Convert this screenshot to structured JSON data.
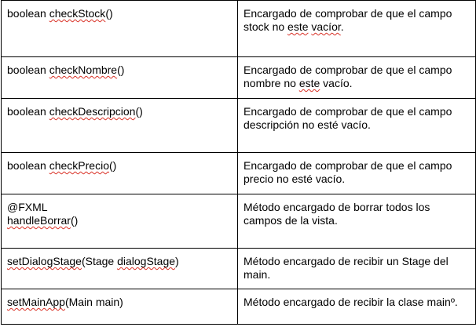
{
  "rows": [
    {
      "sig_parts": [
        {
          "t": "boolean ",
          "sq": false
        },
        {
          "t": "checkStock",
          "sq": true
        },
        {
          "t": "()",
          "sq": false
        }
      ],
      "desc_parts": [
        {
          "t": "Encargado de comprobar de que el campo stock no ",
          "sq": false
        },
        {
          "t": "este",
          "sq": true
        },
        {
          "t": " ",
          "sq": false
        },
        {
          "t": "vacíor",
          "sq": true
        },
        {
          "t": ".",
          "sq": false
        }
      ]
    },
    {
      "sig_parts": [
        {
          "t": "boolean ",
          "sq": false
        },
        {
          "t": "checkNombre",
          "sq": true
        },
        {
          "t": "()",
          "sq": false
        }
      ],
      "desc_parts": [
        {
          "t": "Encargado de comprobar de que el campo nombre no ",
          "sq": false
        },
        {
          "t": "este",
          "sq": true
        },
        {
          "t": " vacío.",
          "sq": false
        }
      ]
    },
    {
      "sig_parts": [
        {
          "t": "boolean ",
          "sq": false
        },
        {
          "t": "checkDescripcion",
          "sq": true
        },
        {
          "t": "()",
          "sq": false
        }
      ],
      "desc_parts": [
        {
          "t": "Encargado de comprobar de que el campo descripción no esté vacío.",
          "sq": false
        }
      ]
    },
    {
      "sig_parts": [
        {
          "t": "boolean ",
          "sq": false
        },
        {
          "t": "checkPrecio",
          "sq": true
        },
        {
          "t": "()",
          "sq": false
        }
      ],
      "desc_parts": [
        {
          "t": "Encargado de comprobar de que el campo precio no esté vacío.",
          "sq": false
        }
      ]
    },
    {
      "sig_parts": [
        {
          "t": "@FXML",
          "sq": false
        },
        {
          "t": "\n",
          "sq": false
        },
        {
          "t": "handleBorrar",
          "sq": true
        },
        {
          "t": "()",
          "sq": false
        }
      ],
      "desc_parts": [
        {
          "t": "Método encargado de borrar todos los campos de la vista.",
          "sq": false
        }
      ]
    },
    {
      "sig_parts": [
        {
          "t": "setDialogStage",
          "sq": true
        },
        {
          "t": "(Stage ",
          "sq": false
        },
        {
          "t": "dialogStage",
          "sq": true
        },
        {
          "t": ")",
          "sq": false
        }
      ],
      "desc_parts": [
        {
          "t": "Método encargado de recibir un Stage del main.",
          "sq": false
        }
      ]
    },
    {
      "sig_parts": [
        {
          "t": "setMainApp",
          "sq": true
        },
        {
          "t": "(Main main)",
          "sq": false
        }
      ],
      "desc_parts": [
        {
          "t": "Método encargado de recibir la clase mainº.",
          "sq": false
        }
      ]
    }
  ]
}
